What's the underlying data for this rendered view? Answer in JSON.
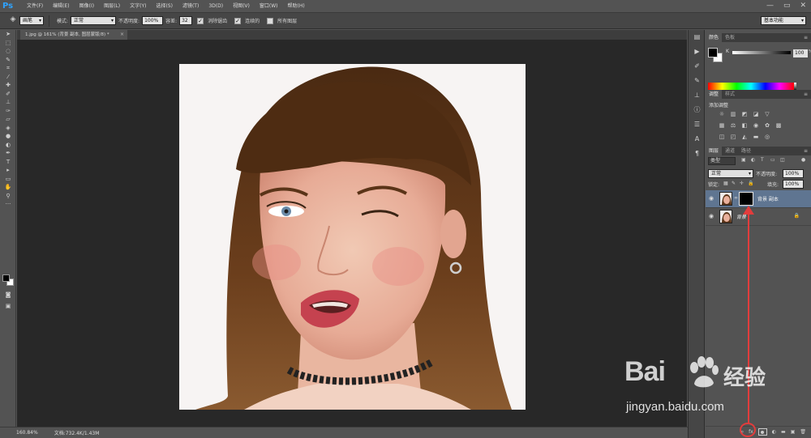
{
  "app": {
    "logo": "Ps",
    "menu": [
      "文件(F)",
      "编辑(E)",
      "图像(I)",
      "图层(L)",
      "文字(Y)",
      "选择(S)",
      "滤镜(T)",
      "3D(D)",
      "视图(V)",
      "窗口(W)",
      "帮助(H)"
    ],
    "window_controls": [
      "—",
      "▭",
      "✕"
    ]
  },
  "options_bar": {
    "brush_preset": "画笔",
    "mode_label": "模式:",
    "mode_value": "正常",
    "opacity_label": "不透明度:",
    "opacity_value": "100%",
    "tolerance_label": "容差:",
    "tolerance_value": "32",
    "antialias_label": "消除锯齿",
    "contiguous_label": "连续的",
    "all_layers_label": "所有图层",
    "workspace": "基本功能"
  },
  "document": {
    "tab_title": "1.jpg @ 161% (背景 副本, 图层蒙版/8) *",
    "tab_close": "×"
  },
  "status_bar": {
    "zoom": "160.84%",
    "doc_size": "文档:732.4K/1.43M"
  },
  "color_panel": {
    "tabs": [
      "颜色",
      "色板"
    ],
    "channel_label": "K",
    "channel_value": "100",
    "channel_unit": "%"
  },
  "adjustments_panel": {
    "tabs": [
      "调整",
      "样式"
    ],
    "title": "添加调整"
  },
  "layers_panel": {
    "tabs": [
      "图层",
      "通道",
      "路径"
    ],
    "filter_kind": "类型",
    "blend_mode": "正常",
    "opacity_label": "不透明度:",
    "opacity_value": "100%",
    "lock_label": "锁定:",
    "fill_label": "填充:",
    "fill_value": "100%",
    "layers": [
      {
        "name": "背景 副本",
        "selected": true,
        "has_mask": true
      },
      {
        "name": "背景",
        "selected": false,
        "has_mask": false,
        "locked": true
      }
    ]
  },
  "watermark": {
    "brand": "Bai",
    "brand_cn": "经验",
    "url": "jingyan.baidu.com"
  },
  "colors": {
    "annotation": "#e23c3c",
    "canvas_bg": "#282828",
    "selected_layer": "#5f7591"
  }
}
